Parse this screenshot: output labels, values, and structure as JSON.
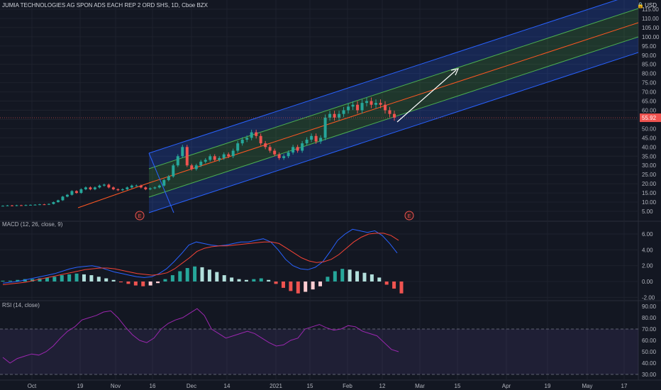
{
  "title": "JUMIA TECHNOLOGIES AG SPON ADS EACH REP 2 ORD SHS, 1D, Cboe BZX",
  "currency": "USD",
  "price_label": "55.92",
  "macd_label": "MACD (12, 26, close, 9)",
  "rsi_label": "RSI (14, close)",
  "earnings_marker": "E",
  "colors": {
    "background": "#131722",
    "grid": "#1e222d",
    "up": "#26a69a",
    "down": "#ef5350",
    "channel_outer": "#2962ff",
    "channel_inner": "#4caf50",
    "channel_mid": "#ff5722",
    "macd_line": "#2962ff",
    "signal_line": "#f44336",
    "rsi_line": "#9c27b0",
    "rsi_band": "#7e57c2"
  },
  "chart_data": [
    {
      "type": "candlestick",
      "ylim": [
        0,
        120
      ],
      "ticks": [
        "5.00",
        "10.00",
        "15.00",
        "20.00",
        "25.00",
        "30.00",
        "35.00",
        "40.00",
        "45.00",
        "50.00",
        "55.00",
        "60.00",
        "65.00",
        "70.00",
        "75.00",
        "80.00",
        "85.00",
        "90.00",
        "95.00",
        "100.00",
        "105.00",
        "110.00",
        "115.00"
      ],
      "x_labels": [
        "Oct",
        "19",
        "Nov",
        "16",
        "Dec",
        "14",
        "2021",
        "15",
        "Feb",
        "12",
        "Mar",
        "15",
        "Apr",
        "19",
        "May",
        "17"
      ],
      "last_price": 55.92,
      "closes": [
        8,
        8.2,
        8,
        8.3,
        8.2,
        8.4,
        8.5,
        8.6,
        8.8,
        8.7,
        9,
        10,
        11,
        13,
        14,
        16,
        15,
        17,
        18,
        17,
        18,
        19,
        19.5,
        18,
        17,
        16.5,
        17,
        18,
        19,
        19,
        18,
        17,
        17.5,
        18,
        19,
        22,
        24,
        30,
        35,
        40,
        30,
        28,
        30,
        32,
        33,
        35,
        33,
        34,
        36,
        35,
        38,
        42,
        44,
        45,
        48,
        46,
        42,
        40,
        38,
        36,
        34,
        35,
        37,
        40,
        38,
        42,
        44,
        46,
        43,
        45,
        56,
        58,
        56,
        58,
        60,
        62,
        63,
        60,
        64,
        65,
        63,
        64,
        63,
        60,
        58,
        56
      ]
    },
    {
      "type": "line",
      "name": "MACD (12, 26, close, 9)",
      "ticks": [
        "-2.00",
        "0.00",
        "2.00",
        "4.00",
        "6.00"
      ],
      "ylim": [
        -3,
        7
      ],
      "macd": [
        -0.2,
        -0.1,
        0,
        0.2,
        0.4,
        0.6,
        0.8,
        1,
        1.3,
        1.6,
        1.8,
        1.9,
        2,
        1.8,
        1.5,
        1.2,
        1,
        0.8,
        0.6,
        0.5,
        0.6,
        1,
        1.6,
        2.5,
        3.5,
        4.6,
        5,
        4.8,
        4.6,
        4.5,
        4.6,
        4.8,
        5,
        5,
        5.2,
        5.4,
        5,
        4,
        2.8,
        2,
        1.6,
        1.5,
        1.8,
        2.5,
        3.8,
        5.2,
        6,
        6.6,
        6.4,
        6.2,
        6.4,
        5.8,
        4.8,
        3.6
      ],
      "signal": [
        -0.4,
        -0.3,
        -0.2,
        -0.1,
        0.1,
        0.3,
        0.5,
        0.7,
        0.9,
        1.1,
        1.3,
        1.5,
        1.6,
        1.7,
        1.7,
        1.6,
        1.4,
        1.2,
        1,
        0.9,
        0.8,
        0.9,
        1.1,
        1.6,
        2.3,
        3,
        3.8,
        4.2,
        4.4,
        4.5,
        4.5,
        4.6,
        4.7,
        4.8,
        4.9,
        5,
        5,
        4.8,
        4.2,
        3.6,
        3,
        2.6,
        2.4,
        2.5,
        2.8,
        3.4,
        4.2,
        5,
        5.6,
        6,
        6.1,
        6.1,
        5.8,
        5.2
      ],
      "histogram": [
        0.1,
        0.1,
        0.2,
        0.3,
        0.3,
        0.4,
        0.5,
        0.6,
        0.8,
        0.9,
        1,
        0.9,
        0.8,
        0.6,
        0.4,
        0.2,
        -0.1,
        -0.3,
        -0.5,
        -0.6,
        -0.5,
        -0.2,
        0.3,
        0.8,
        1.3,
        1.7,
        1.9,
        1.8,
        1.5,
        1.2,
        0.8,
        0.5,
        0.3,
        0.2,
        0.3,
        0.4,
        0.2,
        -0.3,
        -0.8,
        -1.2,
        -1.5,
        -1.3,
        -1,
        -0.6,
        0.6,
        1.3,
        1.6,
        1.5,
        1.3,
        1.1,
        0.9,
        0.5,
        -0.4,
        -0.9,
        -1.5
      ]
    },
    {
      "type": "line",
      "name": "RSI (14, close)",
      "ticks": [
        "30.00",
        "40.00",
        "50.00",
        "60.00",
        "70.00",
        "80.00",
        "90.00"
      ],
      "ylim": [
        25,
        95
      ],
      "band": [
        30,
        70
      ],
      "values": [
        45,
        40,
        44,
        46,
        48,
        47,
        50,
        55,
        62,
        68,
        72,
        78,
        80,
        82,
        85,
        86,
        80,
        72,
        65,
        60,
        58,
        62,
        70,
        75,
        78,
        80,
        84,
        88,
        82,
        70,
        66,
        62,
        64,
        66,
        68,
        66,
        62,
        58,
        55,
        56,
        60,
        62,
        70,
        72,
        74,
        71,
        69,
        70,
        73,
        72,
        68,
        66,
        64,
        58,
        52,
        50
      ]
    }
  ]
}
